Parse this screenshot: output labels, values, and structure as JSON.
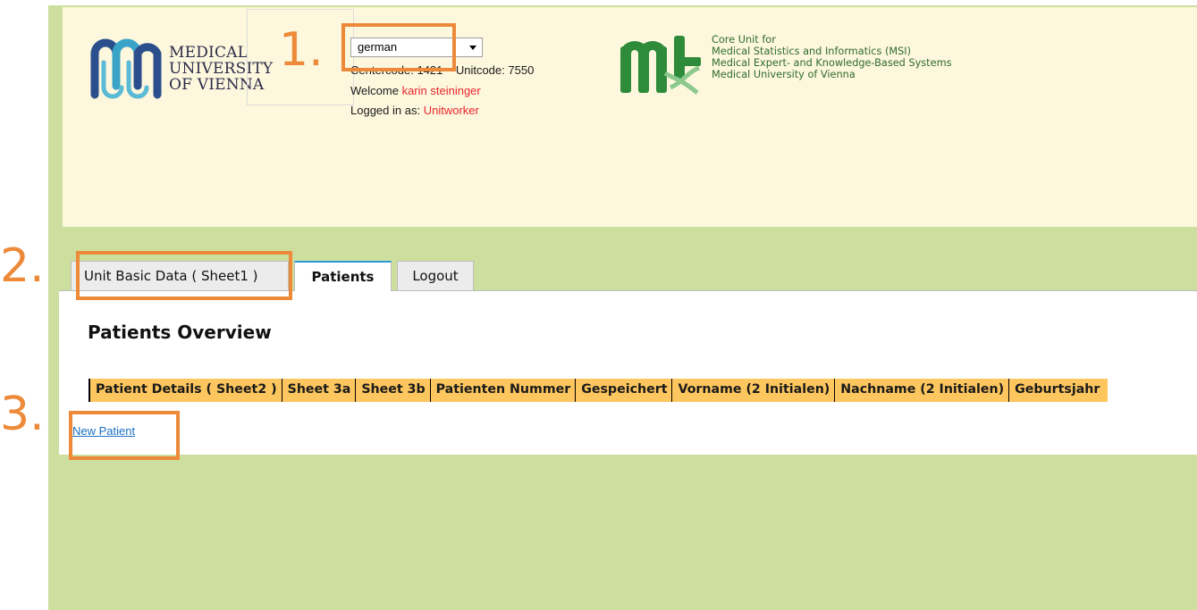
{
  "header": {
    "muv_logo_lines": [
      "MEDICAL",
      "UNIVERSITY",
      "OF VIENNA"
    ],
    "language": {
      "selected": "german"
    },
    "centercode_label": "Centercode:",
    "centercode_value": "1421",
    "unitcode_label": "Unitcode:",
    "unitcode_value": "7550",
    "welcome_label": "Welcome",
    "welcome_user": "karin steininger",
    "logged_in_label": "Logged in as:",
    "logged_in_role": "Unitworker",
    "msi_lines": [
      "Core Unit for",
      "Medical Statistics and Informatics (MSI)",
      "Medical Expert- and Knowledge-Based Systems",
      "Medical University of Vienna"
    ]
  },
  "tabs": [
    {
      "label": "Unit Basic Data ( Sheet1 )"
    },
    {
      "label": "Patients",
      "active": true
    },
    {
      "label": "Logout"
    }
  ],
  "main": {
    "title": "Patients Overview",
    "table_columns": [
      "Patient Details ( Sheet2 )",
      "Sheet 3a",
      "Sheet 3b",
      "Patienten Nummer",
      "Gespeichert",
      "Vorname (2 Initialen)",
      "Nachname (2 Initialen)",
      "Geburtsjahr"
    ],
    "new_patient_link": "New Patient"
  },
  "annotations": [
    "1.",
    "2.",
    "3."
  ],
  "colors": {
    "page_background": "#cddf9f",
    "header_background": "#fdf7dd",
    "table_header": "#fdc65e",
    "annotation": "#ec8a3a",
    "active_tab_accent": "#2c98d8",
    "link": "#1a6fc4",
    "highlight_text": "#e8262c"
  }
}
